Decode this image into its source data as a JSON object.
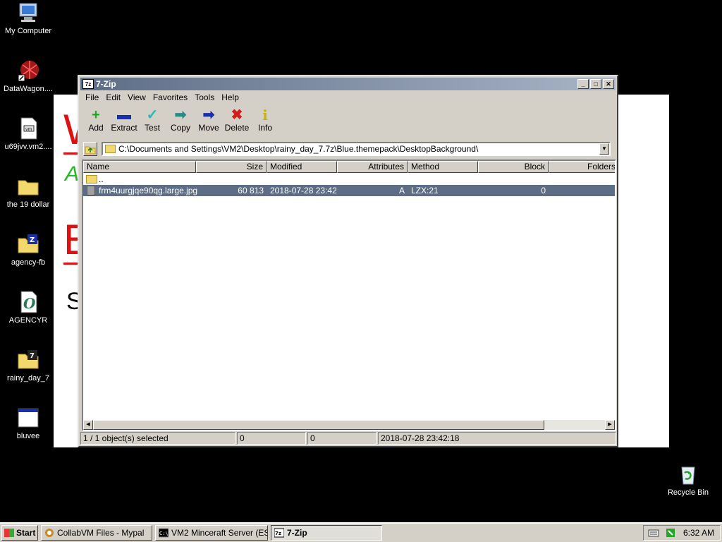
{
  "desktop_icons": [
    {
      "label": "My Computer",
      "icon": "computer-icon"
    },
    {
      "label": "DataWagon....",
      "icon": "datawagon-icon"
    },
    {
      "label": "u69jvv.vm2....",
      "icon": "file-icon"
    },
    {
      "label": "the 19 dollar",
      "icon": "folder-icon"
    },
    {
      "label": "agency-fb",
      "icon": "archive-folder-icon"
    },
    {
      "label": "AGENCYR",
      "icon": "font-file-icon"
    },
    {
      "label": "rainy_day_7",
      "icon": "archive-folder-icon"
    },
    {
      "label": "bluvee",
      "icon": "window-icon"
    },
    {
      "label": "Recycle Bin",
      "icon": "recycle-bin-icon"
    }
  ],
  "window": {
    "title": "7-Zip",
    "icon_text": "7z",
    "menu": [
      "File",
      "Edit",
      "View",
      "Favorites",
      "Tools",
      "Help"
    ],
    "toolbar": [
      {
        "label": "Add",
        "icon": "plus-icon",
        "color": "#1fa51f",
        "glyph": "+"
      },
      {
        "label": "Extract",
        "icon": "minus-icon",
        "color": "#1a2fa8",
        "glyph": "▬"
      },
      {
        "label": "Test",
        "icon": "check-icon",
        "color": "#2bb7b7",
        "glyph": "✓"
      },
      {
        "label": "Copy",
        "icon": "arrow-right-icon",
        "color": "#2a8a8a",
        "glyph": "➡"
      },
      {
        "label": "Move",
        "icon": "arrow-right-icon",
        "color": "#1a2fa8",
        "glyph": "➡"
      },
      {
        "label": "Delete",
        "icon": "x-icon",
        "color": "#d41a1a",
        "glyph": "✖"
      },
      {
        "label": "Info",
        "icon": "info-icon",
        "color": "#c9b400",
        "glyph": "i"
      }
    ],
    "address": "C:\\Documents and Settings\\VM2\\Desktop\\rainy_day_7.7z\\Blue.themepack\\DesktopBackground\\",
    "columns": [
      "Name",
      "Size",
      "Modified",
      "Attributes",
      "Method",
      "Block",
      "Folders"
    ],
    "rows": [
      {
        "name": "..",
        "size": "",
        "modified": "",
        "attributes": "",
        "method": "",
        "block": "",
        "type": "folder"
      },
      {
        "name": "frm4uurgjqe90qg.large.jpg",
        "size": "60 813",
        "modified": "2018-07-28 23:42",
        "attributes": "A",
        "method": "LZX:21",
        "block": "0",
        "type": "file"
      }
    ],
    "status": [
      "1 / 1 object(s) selected",
      "0",
      "0",
      "2018-07-28 23:42:18"
    ]
  },
  "taskbar": {
    "start_label": "Start",
    "tasks": [
      {
        "label": "CollabVM Files - Mypal",
        "active": false
      },
      {
        "label": "VM2 Minceraft Server (ES...",
        "active": false
      },
      {
        "label": "7-Zip",
        "active": true
      }
    ],
    "clock": "6:32 AM"
  },
  "colors": {
    "titlebar": "#5e6d86",
    "selection": "#5e6d86",
    "face": "#d4d0c8"
  }
}
